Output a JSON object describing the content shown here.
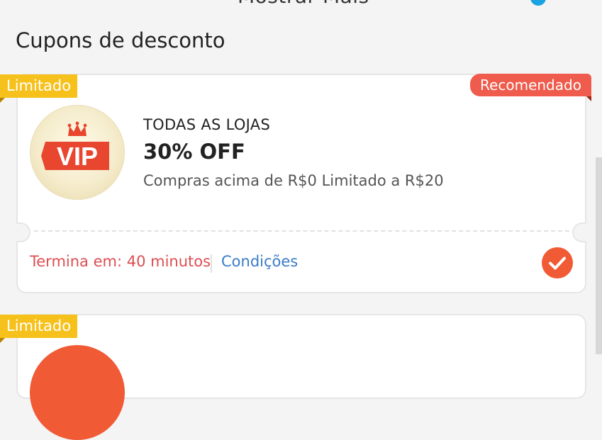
{
  "header": {
    "partial_title": "Mostrar Mais"
  },
  "section": {
    "title": "Cupons de desconto"
  },
  "coupons": [
    {
      "limited_badge": "Limitado",
      "recommended_badge": "Recomendado",
      "logo_text": "VIP",
      "store": "TODAS AS LOJAS",
      "discount": "30% OFF",
      "condition": "Compras acima de R$0 Limitado a R$20",
      "expires": "Termina em: 40 minutos",
      "conditions_link": "Condições",
      "selected": true
    },
    {
      "limited_badge": "Limitado"
    }
  ],
  "colors": {
    "limited_badge": "#f7c11b",
    "recommended_badge": "#ef5b4c",
    "expires_text": "#dd4e52",
    "link": "#3a7cc8",
    "check": "#f05a35"
  },
  "icons": {
    "logo": "vip-crown-icon",
    "select": "checkmark-icon"
  }
}
